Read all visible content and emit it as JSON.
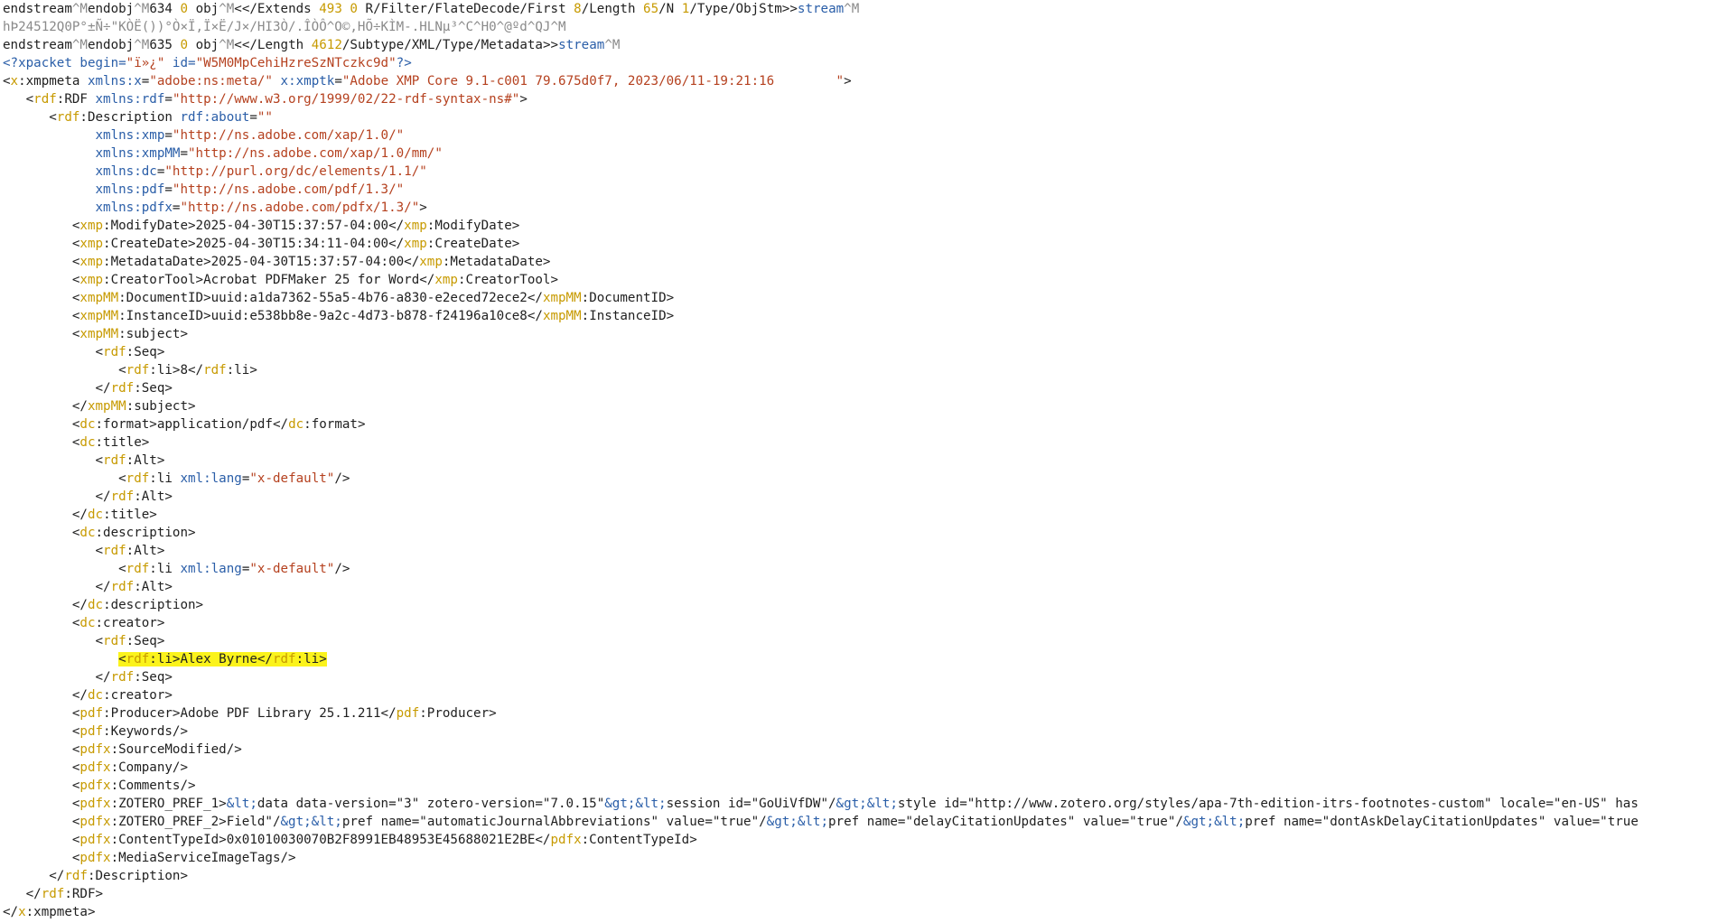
{
  "editor": {
    "highlight_line_index": 36,
    "lines": [
      [
        [
          "text",
          "endstream"
        ],
        [
          "ctrl",
          "^M"
        ],
        [
          "text",
          "endobj"
        ],
        [
          "ctrl",
          "^M"
        ],
        [
          "text",
          "634 "
        ],
        [
          "num",
          "0"
        ],
        [
          "text",
          " obj"
        ],
        [
          "ctrl",
          "^M"
        ],
        [
          "text",
          "<</Extends "
        ],
        [
          "num",
          "493 0"
        ],
        [
          "text",
          " R/Filter/FlateDecode/First "
        ],
        [
          "num",
          "8"
        ],
        [
          "text",
          "/Length "
        ],
        [
          "num",
          "65"
        ],
        [
          "text",
          "/N "
        ],
        [
          "num",
          "1"
        ],
        [
          "text",
          "/Type/ObjStm>>"
        ],
        [
          "kw",
          "stream"
        ],
        [
          "ctrl",
          "^M"
        ]
      ],
      [
        [
          "bin",
          "hÞ24512Q0P°±Ñ÷\"KÒË())°Ò×Ï,Ï×Ë/J×/HI3Ò/.ÎÒÔ^O©,HÕ÷KÌM-.HLNµ³^C^H0^@ºd^QJ^M"
        ]
      ],
      [
        [
          "text",
          "endstream"
        ],
        [
          "ctrl",
          "^M"
        ],
        [
          "text",
          "endobj"
        ],
        [
          "ctrl",
          "^M"
        ],
        [
          "text",
          "635 "
        ],
        [
          "num",
          "0"
        ],
        [
          "text",
          " obj"
        ],
        [
          "ctrl",
          "^M"
        ],
        [
          "text",
          "<</Length "
        ],
        [
          "num",
          "4612"
        ],
        [
          "text",
          "/Subtype/XML/Type/Metadata>>"
        ],
        [
          "kw",
          "stream"
        ],
        [
          "ctrl",
          "^M"
        ]
      ],
      [
        [
          "pi",
          "<?xpacket begin="
        ],
        [
          "str",
          "\"ï»¿\""
        ],
        [
          "pi",
          " id="
        ],
        [
          "str",
          "\"W5M0MpCehiHzreSzNTczkc9d\""
        ],
        [
          "pi",
          "?>"
        ]
      ],
      [
        [
          "text",
          "<"
        ],
        [
          "ns",
          "x"
        ],
        [
          "text",
          ":xmpmeta "
        ],
        [
          "attr",
          "xmlns:x"
        ],
        [
          "text",
          "="
        ],
        [
          "str",
          "\"adobe:ns:meta/\""
        ],
        [
          "text",
          " "
        ],
        [
          "attr",
          "x:xmptk"
        ],
        [
          "text",
          "="
        ],
        [
          "str",
          "\"Adobe XMP Core 9.1-c001 79.675d0f7, 2023/06/11-19:21:16        \""
        ],
        [
          "text",
          ">"
        ]
      ],
      [
        [
          "text",
          "   <"
        ],
        [
          "ns",
          "rdf"
        ],
        [
          "text",
          ":RDF "
        ],
        [
          "attr",
          "xmlns:rdf"
        ],
        [
          "text",
          "="
        ],
        [
          "str",
          "\"http://www.w3.org/1999/02/22-rdf-syntax-ns#\""
        ],
        [
          "text",
          ">"
        ]
      ],
      [
        [
          "text",
          "      <"
        ],
        [
          "ns",
          "rdf"
        ],
        [
          "text",
          ":Description "
        ],
        [
          "attr",
          "rdf:about"
        ],
        [
          "text",
          "="
        ],
        [
          "str",
          "\"\""
        ]
      ],
      [
        [
          "text",
          "            "
        ],
        [
          "attr",
          "xmlns:xmp"
        ],
        [
          "text",
          "="
        ],
        [
          "str",
          "\"http://ns.adobe.com/xap/1.0/\""
        ]
      ],
      [
        [
          "text",
          "            "
        ],
        [
          "attr",
          "xmlns:xmpMM"
        ],
        [
          "text",
          "="
        ],
        [
          "str",
          "\"http://ns.adobe.com/xap/1.0/mm/\""
        ]
      ],
      [
        [
          "text",
          "            "
        ],
        [
          "attr",
          "xmlns:dc"
        ],
        [
          "text",
          "="
        ],
        [
          "str",
          "\"http://purl.org/dc/elements/1.1/\""
        ]
      ],
      [
        [
          "text",
          "            "
        ],
        [
          "attr",
          "xmlns:pdf"
        ],
        [
          "text",
          "="
        ],
        [
          "str",
          "\"http://ns.adobe.com/pdf/1.3/\""
        ]
      ],
      [
        [
          "text",
          "            "
        ],
        [
          "attr",
          "xmlns:pdfx"
        ],
        [
          "text",
          "="
        ],
        [
          "str",
          "\"http://ns.adobe.com/pdfx/1.3/\""
        ],
        [
          "text",
          ">"
        ]
      ],
      [
        [
          "text",
          "         <"
        ],
        [
          "ns",
          "xmp"
        ],
        [
          "text",
          ":ModifyDate>2025-04-30T15:37:57-04:00</"
        ],
        [
          "ns",
          "xmp"
        ],
        [
          "text",
          ":ModifyDate>"
        ]
      ],
      [
        [
          "text",
          "         <"
        ],
        [
          "ns",
          "xmp"
        ],
        [
          "text",
          ":CreateDate>2025-04-30T15:34:11-04:00</"
        ],
        [
          "ns",
          "xmp"
        ],
        [
          "text",
          ":CreateDate>"
        ]
      ],
      [
        [
          "text",
          "         <"
        ],
        [
          "ns",
          "xmp"
        ],
        [
          "text",
          ":MetadataDate>2025-04-30T15:37:57-04:00</"
        ],
        [
          "ns",
          "xmp"
        ],
        [
          "text",
          ":MetadataDate>"
        ]
      ],
      [
        [
          "text",
          "         <"
        ],
        [
          "ns",
          "xmp"
        ],
        [
          "text",
          ":CreatorTool>Acrobat PDFMaker 25 for Word</"
        ],
        [
          "ns",
          "xmp"
        ],
        [
          "text",
          ":CreatorTool>"
        ]
      ],
      [
        [
          "text",
          "         <"
        ],
        [
          "ns",
          "xmpMM"
        ],
        [
          "text",
          ":DocumentID>uuid:a1da7362-55a5-4b76-a830-e2eced72ece2</"
        ],
        [
          "ns",
          "xmpMM"
        ],
        [
          "text",
          ":DocumentID>"
        ]
      ],
      [
        [
          "text",
          "         <"
        ],
        [
          "ns",
          "xmpMM"
        ],
        [
          "text",
          ":InstanceID>uuid:e538bb8e-9a2c-4d73-b878-f24196a10ce8</"
        ],
        [
          "ns",
          "xmpMM"
        ],
        [
          "text",
          ":InstanceID>"
        ]
      ],
      [
        [
          "text",
          "         <"
        ],
        [
          "ns",
          "xmpMM"
        ],
        [
          "text",
          ":subject>"
        ]
      ],
      [
        [
          "text",
          "            <"
        ],
        [
          "ns",
          "rdf"
        ],
        [
          "text",
          ":Seq>"
        ]
      ],
      [
        [
          "text",
          "               <"
        ],
        [
          "ns",
          "rdf"
        ],
        [
          "text",
          ":li>8</"
        ],
        [
          "ns",
          "rdf"
        ],
        [
          "text",
          ":li>"
        ]
      ],
      [
        [
          "text",
          "            </"
        ],
        [
          "ns",
          "rdf"
        ],
        [
          "text",
          ":Seq>"
        ]
      ],
      [
        [
          "text",
          "         </"
        ],
        [
          "ns",
          "xmpMM"
        ],
        [
          "text",
          ":subject>"
        ]
      ],
      [
        [
          "text",
          "         <"
        ],
        [
          "ns",
          "dc"
        ],
        [
          "text",
          ":format>application/pdf</"
        ],
        [
          "ns",
          "dc"
        ],
        [
          "text",
          ":format>"
        ]
      ],
      [
        [
          "text",
          "         <"
        ],
        [
          "ns",
          "dc"
        ],
        [
          "text",
          ":title>"
        ]
      ],
      [
        [
          "text",
          "            <"
        ],
        [
          "ns",
          "rdf"
        ],
        [
          "text",
          ":Alt>"
        ]
      ],
      [
        [
          "text",
          "               <"
        ],
        [
          "ns",
          "rdf"
        ],
        [
          "text",
          ":li "
        ],
        [
          "attr",
          "xml:lang"
        ],
        [
          "text",
          "="
        ],
        [
          "str",
          "\"x-default\""
        ],
        [
          "text",
          "/>"
        ]
      ],
      [
        [
          "text",
          "            </"
        ],
        [
          "ns",
          "rdf"
        ],
        [
          "text",
          ":Alt>"
        ]
      ],
      [
        [
          "text",
          "         </"
        ],
        [
          "ns",
          "dc"
        ],
        [
          "text",
          ":title>"
        ]
      ],
      [
        [
          "text",
          "         <"
        ],
        [
          "ns",
          "dc"
        ],
        [
          "text",
          ":description>"
        ]
      ],
      [
        [
          "text",
          "            <"
        ],
        [
          "ns",
          "rdf"
        ],
        [
          "text",
          ":Alt>"
        ]
      ],
      [
        [
          "text",
          "               <"
        ],
        [
          "ns",
          "rdf"
        ],
        [
          "text",
          ":li "
        ],
        [
          "attr",
          "xml:lang"
        ],
        [
          "text",
          "="
        ],
        [
          "str",
          "\"x-default\""
        ],
        [
          "text",
          "/>"
        ]
      ],
      [
        [
          "text",
          "            </"
        ],
        [
          "ns",
          "rdf"
        ],
        [
          "text",
          ":Alt>"
        ]
      ],
      [
        [
          "text",
          "         </"
        ],
        [
          "ns",
          "dc"
        ],
        [
          "text",
          ":description>"
        ]
      ],
      [
        [
          "text",
          "         <"
        ],
        [
          "ns",
          "dc"
        ],
        [
          "text",
          ":creator>"
        ]
      ],
      [
        [
          "text",
          "            <"
        ],
        [
          "ns",
          "rdf"
        ],
        [
          "text",
          ":Seq>"
        ]
      ],
      [
        [
          "text",
          "               "
        ],
        [
          "mark",
          "<"
        ],
        [
          "mark-ns",
          "rdf"
        ],
        [
          "mark",
          ":li>Alex Byrne</"
        ],
        [
          "mark-ns",
          "rdf"
        ],
        [
          "mark",
          ":li>"
        ]
      ],
      [
        [
          "text",
          "            </"
        ],
        [
          "ns",
          "rdf"
        ],
        [
          "text",
          ":Seq>"
        ]
      ],
      [
        [
          "text",
          "         </"
        ],
        [
          "ns",
          "dc"
        ],
        [
          "text",
          ":creator>"
        ]
      ],
      [
        [
          "text",
          "         <"
        ],
        [
          "ns",
          "pdf"
        ],
        [
          "text",
          ":Producer>Adobe PDF Library 25.1.211</"
        ],
        [
          "ns",
          "pdf"
        ],
        [
          "text",
          ":Producer>"
        ]
      ],
      [
        [
          "text",
          "         <"
        ],
        [
          "ns",
          "pdf"
        ],
        [
          "text",
          ":Keywords/>"
        ]
      ],
      [
        [
          "text",
          "         <"
        ],
        [
          "ns",
          "pdfx"
        ],
        [
          "text",
          ":SourceModified/>"
        ]
      ],
      [
        [
          "text",
          "         <"
        ],
        [
          "ns",
          "pdfx"
        ],
        [
          "text",
          ":Company/>"
        ]
      ],
      [
        [
          "text",
          "         <"
        ],
        [
          "ns",
          "pdfx"
        ],
        [
          "text",
          ":Comments/>"
        ]
      ],
      [
        [
          "text",
          "         <"
        ],
        [
          "ns",
          "pdfx"
        ],
        [
          "text",
          ":ZOTERO_PREF_1>"
        ],
        [
          "ent",
          "&lt;"
        ],
        [
          "text",
          "data data-version=\"3\" zotero-version=\"7.0.15\""
        ],
        [
          "ent",
          "&gt;&lt;"
        ],
        [
          "text",
          "session id=\"GoUiVfDW\"/"
        ],
        [
          "ent",
          "&gt;&lt;"
        ],
        [
          "text",
          "style id=\"http://www.zotero.org/styles/apa-7th-edition-itrs-footnotes-custom\" locale=\"en-US\" has"
        ]
      ],
      [
        [
          "text",
          "         <"
        ],
        [
          "ns",
          "pdfx"
        ],
        [
          "text",
          ":ZOTERO_PREF_2>Field\"/"
        ],
        [
          "ent",
          "&gt;&lt;"
        ],
        [
          "text",
          "pref name=\"automaticJournalAbbreviations\" value=\"true\"/"
        ],
        [
          "ent",
          "&gt;&lt;"
        ],
        [
          "text",
          "pref name=\"delayCitationUpdates\" value=\"true\"/"
        ],
        [
          "ent",
          "&gt;&lt;"
        ],
        [
          "text",
          "pref name=\"dontAskDelayCitationUpdates\" value=\"true"
        ]
      ],
      [
        [
          "text",
          "         <"
        ],
        [
          "ns",
          "pdfx"
        ],
        [
          "text",
          ":ContentTypeId>0x01010030070B2F8991EB48953E45688021E2BE</"
        ],
        [
          "ns",
          "pdfx"
        ],
        [
          "text",
          ":ContentTypeId>"
        ]
      ],
      [
        [
          "text",
          "         <"
        ],
        [
          "ns",
          "pdfx"
        ],
        [
          "text",
          ":MediaServiceImageTags/>"
        ]
      ],
      [
        [
          "text",
          "      </"
        ],
        [
          "ns",
          "rdf"
        ],
        [
          "text",
          ":Description>"
        ]
      ],
      [
        [
          "text",
          "   </"
        ],
        [
          "ns",
          "rdf"
        ],
        [
          "text",
          ":RDF>"
        ]
      ],
      [
        [
          "text",
          "</"
        ],
        [
          "ns",
          "x"
        ],
        [
          "text",
          ":xmpmeta>"
        ]
      ]
    ]
  }
}
